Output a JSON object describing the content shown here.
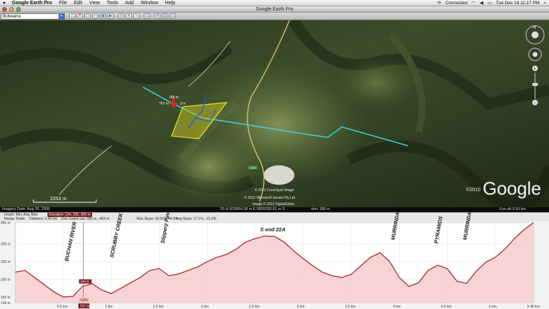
{
  "menubar": {
    "app_name": "Google Earth Pro",
    "items": [
      "File",
      "Edit",
      "View",
      "Tools",
      "Add",
      "Window",
      "Help"
    ],
    "status": {
      "connected": "Connected",
      "clock": "Tue Dec 18  11:17 PM"
    }
  },
  "window": {
    "title": "Google Earth Pro"
  },
  "toolbar": {
    "search_value": "Bolwarra"
  },
  "map": {
    "dist_top": "188 m",
    "dist_left": "707 m",
    "dist_right": "3 m",
    "road_label": "C501",
    "copyright": [
      "© 2012 Cnes/Spot Image",
      "© 2012 Whereis® Sensis Pty Ltd",
      "Image © 2012 DigitalGlobe"
    ],
    "google_copyright": "©2010",
    "google_logo": "Google",
    "scale_label": "2253 m"
  },
  "status_strip": {
    "imagery_date": "Imagery Date: Aug 26, 2006",
    "coordinates": "55 H 603864.58 m E 5855330.81 m S",
    "elev": "elev  188 m",
    "eye_alt": "Eye alt    9.50 km"
  },
  "profile": {
    "header": {
      "graph": "Graph: Min, Avg, Max",
      "elevation": "Elevation: 134, 235, 360 m",
      "range_totals": "Range Totals:",
      "distance": "Distance: 5.40 km",
      "gain_loss": "Elev Gain/Loss: 586 m, -454 m",
      "max_slope": "Max Slope: 43.5%, -44.8%",
      "avg_slope": "Avg Slope: 17.1%, -21.9%"
    },
    "cursor": {
      "elev_label": "188 m",
      "slope_label": "3.4%",
      "dist_label": "707 m"
    }
  },
  "chart_data": {
    "type": "area",
    "xlabel": "",
    "ylabel": "",
    "xlim": [
      0,
      5.4
    ],
    "ylim": [
      134,
      360
    ],
    "y_ticks": [
      "360 m",
      "300 m",
      "250 m",
      "200 m",
      "150 m",
      "134 m"
    ],
    "x_ticks": [
      "0.5 km",
      "1 km",
      "1.5 km",
      "2 km",
      "2.5 km",
      "3 km",
      "3.5 km",
      "4 km",
      "4.5 km",
      "5 km",
      "5.40 km"
    ],
    "x": [
      0,
      0.1,
      0.2,
      0.3,
      0.4,
      0.5,
      0.6,
      0.7,
      0.8,
      0.9,
      1.0,
      1.1,
      1.2,
      1.3,
      1.4,
      1.5,
      1.6,
      1.7,
      1.8,
      1.9,
      2.0,
      2.1,
      2.2,
      2.3,
      2.4,
      2.5,
      2.6,
      2.7,
      2.8,
      2.9,
      3.0,
      3.1,
      3.2,
      3.3,
      3.4,
      3.5,
      3.6,
      3.7,
      3.8,
      3.9,
      4.0,
      4.1,
      4.2,
      4.3,
      4.4,
      4.5,
      4.6,
      4.7,
      4.8,
      4.9,
      5.0,
      5.1,
      5.2,
      5.3,
      5.4
    ],
    "y": [
      220,
      225,
      205,
      185,
      165,
      150,
      152,
      180,
      188,
      170,
      160,
      175,
      190,
      205,
      225,
      230,
      210,
      215,
      225,
      235,
      250,
      262,
      270,
      285,
      305,
      315,
      322,
      321,
      305,
      280,
      258,
      238,
      220,
      210,
      205,
      214,
      238,
      262,
      275,
      250,
      205,
      180,
      190,
      225,
      240,
      230,
      195,
      188,
      222,
      248,
      262,
      285,
      315,
      340,
      360
    ],
    "annotations": [
      "BUCHAN RIVER",
      "SCRUBBY CREEK",
      "Slippery Pinch Rd",
      "S end 22A",
      "MURRINDAL RIVER",
      "PYRAMIDS",
      "MURRINDAL RIVER"
    ]
  }
}
